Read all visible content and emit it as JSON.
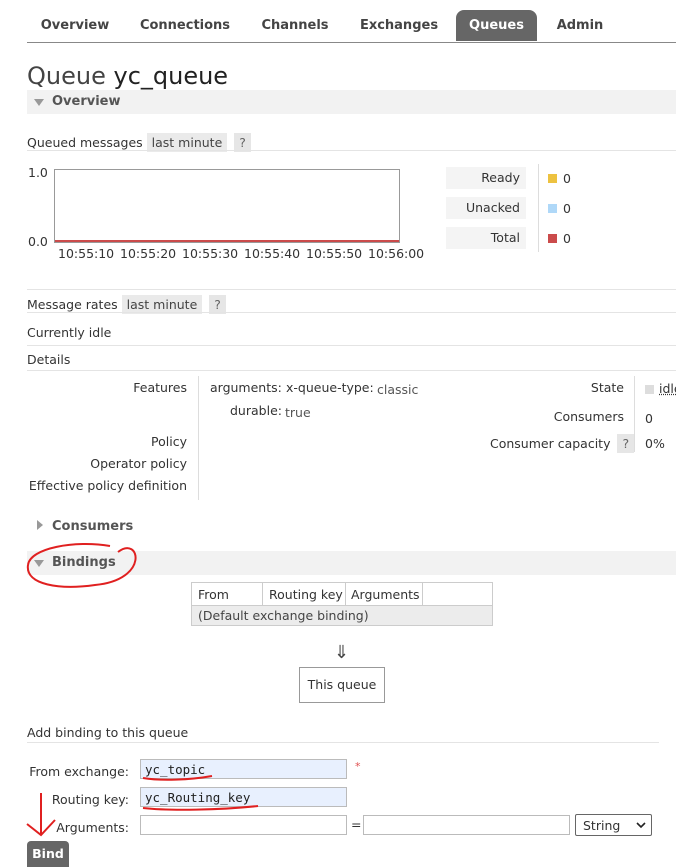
{
  "nav": {
    "tabs": [
      {
        "label": "Overview"
      },
      {
        "label": "Connections"
      },
      {
        "label": "Channels"
      },
      {
        "label": "Exchanges"
      },
      {
        "label": "Queues",
        "active": true
      },
      {
        "label": "Admin"
      }
    ]
  },
  "title": {
    "prefix": "Queue",
    "name": "yc_queue"
  },
  "overview": {
    "section_label": "Overview",
    "queued_messages_label": "Queued messages",
    "queued_range": "last minute",
    "help": "?",
    "chart": {
      "y_top": "1.0",
      "y_bottom": "0.0",
      "x_ticks": [
        "10:55:10",
        "10:55:20",
        "10:55:30",
        "10:55:40",
        "10:55:50",
        "10:56:00"
      ]
    },
    "legend": [
      {
        "label": "Ready",
        "value": "0",
        "color": "#edc240"
      },
      {
        "label": "Unacked",
        "value": "0",
        "color": "#afd8f8"
      },
      {
        "label": "Total",
        "value": "0",
        "color": "#cb4b4b"
      }
    ],
    "message_rates_label": "Message rates",
    "rates_range": "last minute",
    "idle_text": "Currently idle",
    "details_label": "Details",
    "details": {
      "features_label": "Features",
      "arguments_label": "arguments:",
      "queue_type_key": "x-queue-type:",
      "queue_type_value": "classic",
      "durable_key": "durable:",
      "durable_value": "true",
      "policy_label": "Policy",
      "operator_policy_label": "Operator policy",
      "effective_policy_label": "Effective policy definition",
      "state_label": "State",
      "state_value": "idle",
      "consumers_label": "Consumers",
      "consumers_value": "0",
      "capacity_label": "Consumer capacity",
      "capacity_value": "0%"
    }
  },
  "consumers_section": {
    "label": "Consumers"
  },
  "bindings": {
    "section_label": "Bindings",
    "headers": [
      "From",
      "Routing key",
      "Arguments"
    ],
    "default_row": "(Default exchange binding)",
    "arrow": "⇓",
    "this_queue": "This queue"
  },
  "add_binding": {
    "heading": "Add binding to this queue",
    "from_label": "From exchange:",
    "from_value": "yc_topic",
    "required_mark": "*",
    "routing_label": "Routing key:",
    "routing_value": "yc_Routing_key",
    "arguments_label": "Arguments:",
    "equals": "=",
    "type_selected": "String",
    "bind_label": "Bind"
  },
  "annotation": {
    "color": "#e02020"
  }
}
